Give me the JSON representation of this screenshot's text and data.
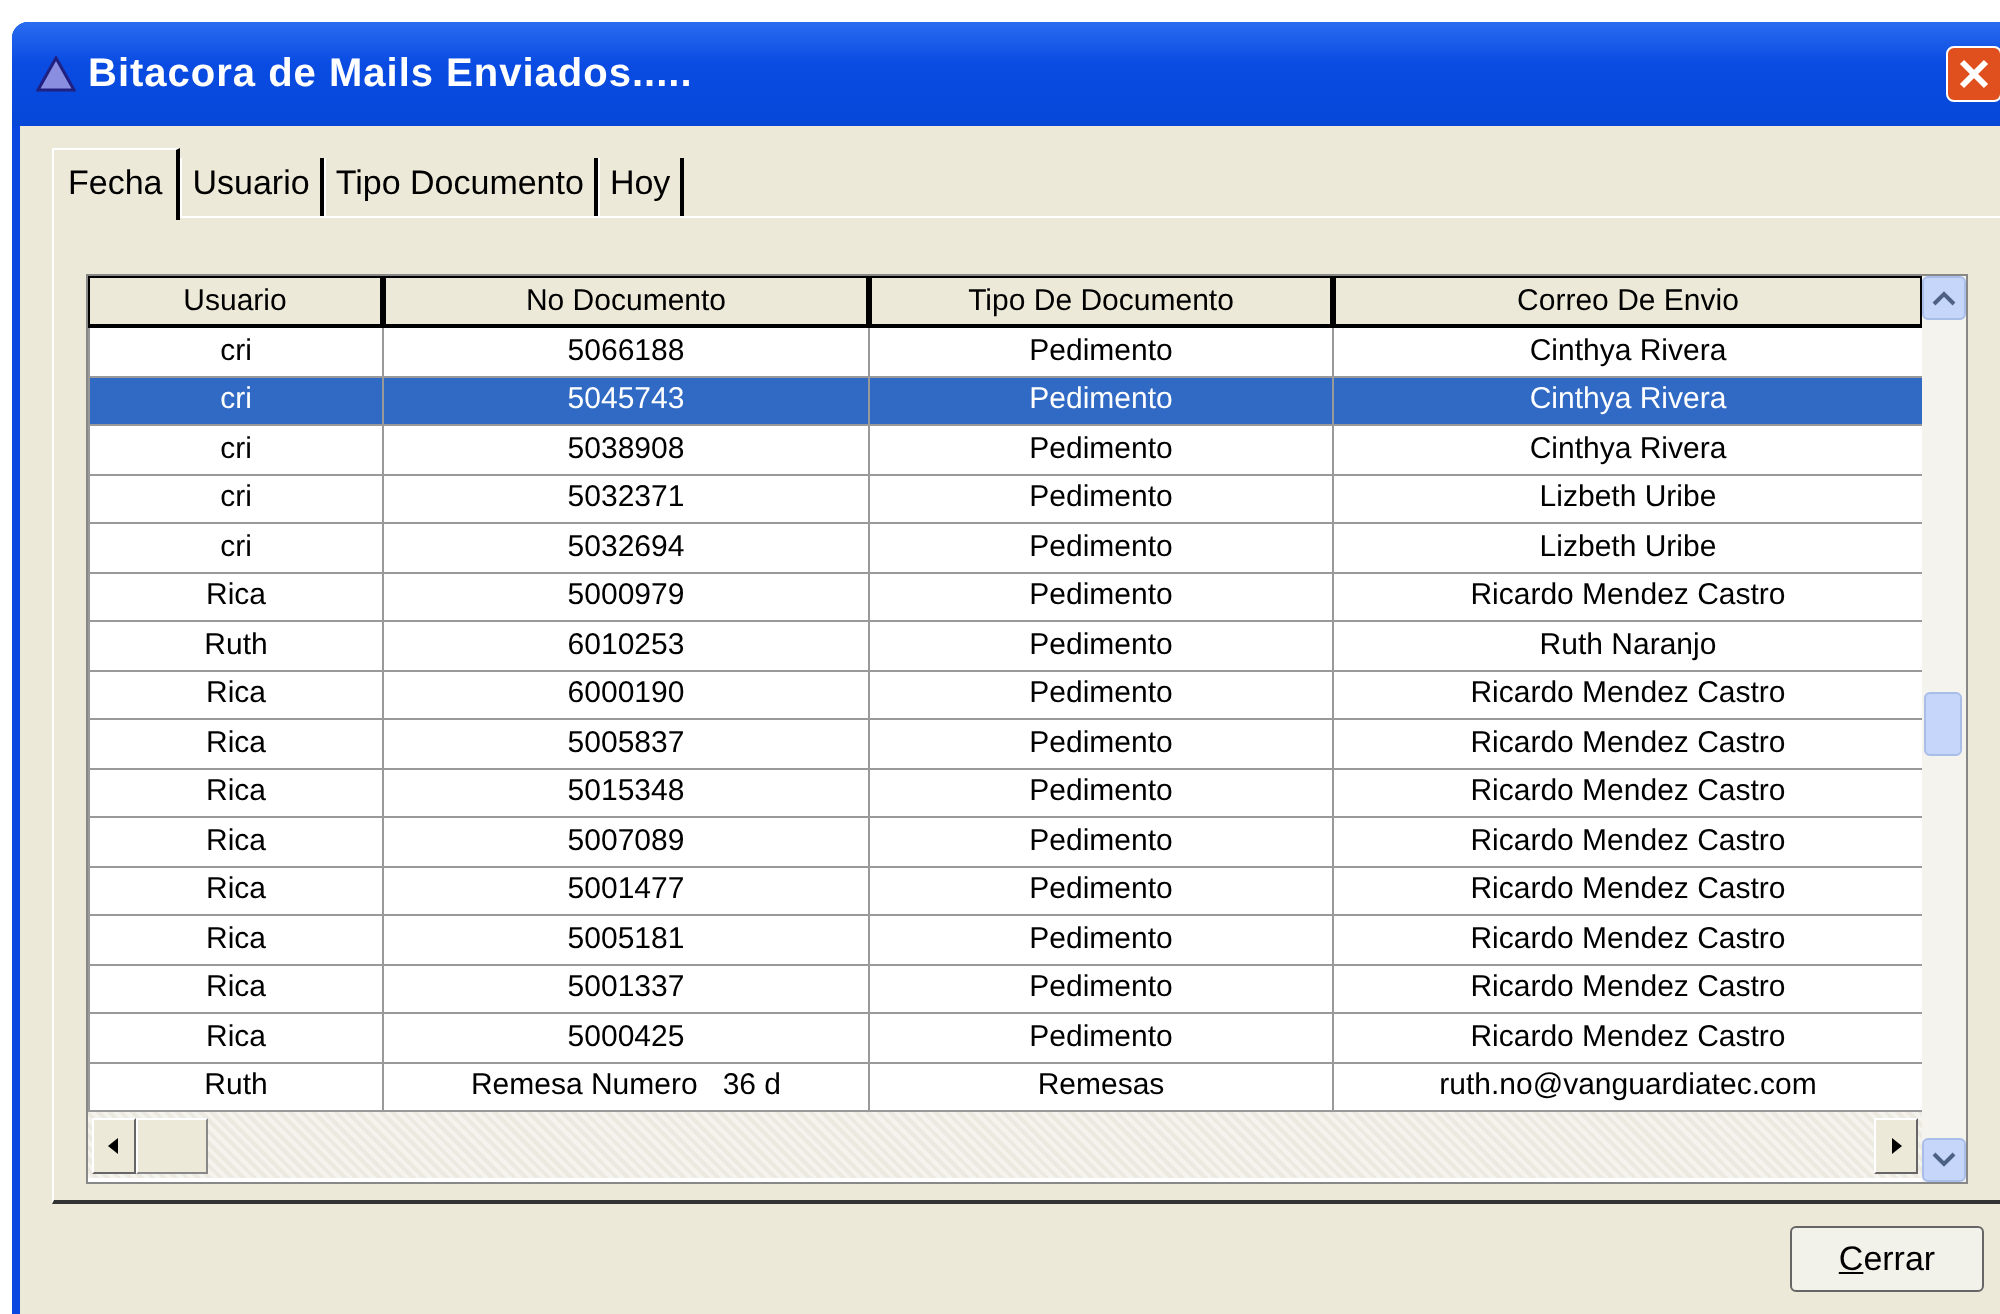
{
  "window": {
    "title": "Bitacora de Mails Enviados....."
  },
  "tabs": [
    {
      "label": "Fecha",
      "selected": true
    },
    {
      "label": "Usuario",
      "selected": false
    },
    {
      "label": "Tipo Documento",
      "selected": false
    },
    {
      "label": "Hoy",
      "selected": false
    }
  ],
  "table": {
    "columns": [
      "Usuario",
      "No Documento",
      "Tipo De Documento",
      "Correo De Envio"
    ],
    "rows": [
      {
        "cells": [
          "cri",
          "5066188",
          "Pedimento",
          "Cinthya Rivera"
        ],
        "selected": false
      },
      {
        "cells": [
          "cri",
          "5045743",
          "Pedimento",
          "Cinthya Rivera"
        ],
        "selected": true
      },
      {
        "cells": [
          "cri",
          "5038908",
          "Pedimento",
          "Cinthya Rivera"
        ],
        "selected": false
      },
      {
        "cells": [
          "cri",
          "5032371",
          "Pedimento",
          "Lizbeth Uribe"
        ],
        "selected": false
      },
      {
        "cells": [
          "cri",
          "5032694",
          "Pedimento",
          "Lizbeth Uribe"
        ],
        "selected": false
      },
      {
        "cells": [
          "Rica",
          "5000979",
          "Pedimento",
          "Ricardo Mendez Castro"
        ],
        "selected": false
      },
      {
        "cells": [
          "Ruth",
          "6010253",
          "Pedimento",
          "Ruth Naranjo"
        ],
        "selected": false
      },
      {
        "cells": [
          "Rica",
          "6000190",
          "Pedimento",
          "Ricardo Mendez Castro"
        ],
        "selected": false
      },
      {
        "cells": [
          "Rica",
          "5005837",
          "Pedimento",
          "Ricardo Mendez Castro"
        ],
        "selected": false
      },
      {
        "cells": [
          "Rica",
          "5015348",
          "Pedimento",
          "Ricardo Mendez Castro"
        ],
        "selected": false
      },
      {
        "cells": [
          "Rica",
          "5007089",
          "Pedimento",
          "Ricardo Mendez Castro"
        ],
        "selected": false
      },
      {
        "cells": [
          "Rica",
          "5001477",
          "Pedimento",
          "Ricardo Mendez Castro"
        ],
        "selected": false
      },
      {
        "cells": [
          "Rica",
          "5005181",
          "Pedimento",
          "Ricardo Mendez Castro"
        ],
        "selected": false
      },
      {
        "cells": [
          "Rica",
          "5001337",
          "Pedimento",
          "Ricardo Mendez Castro"
        ],
        "selected": false
      },
      {
        "cells": [
          "Rica",
          "5000425",
          "Pedimento",
          "Ricardo Mendez Castro"
        ],
        "selected": false
      },
      {
        "cells": [
          "Ruth",
          "Remesa Numero   36 d",
          "Remesas",
          "ruth.no@vanguardiatec.com"
        ],
        "selected": false
      }
    ]
  },
  "buttons": [
    {
      "label": "Cerrar"
    }
  ]
}
